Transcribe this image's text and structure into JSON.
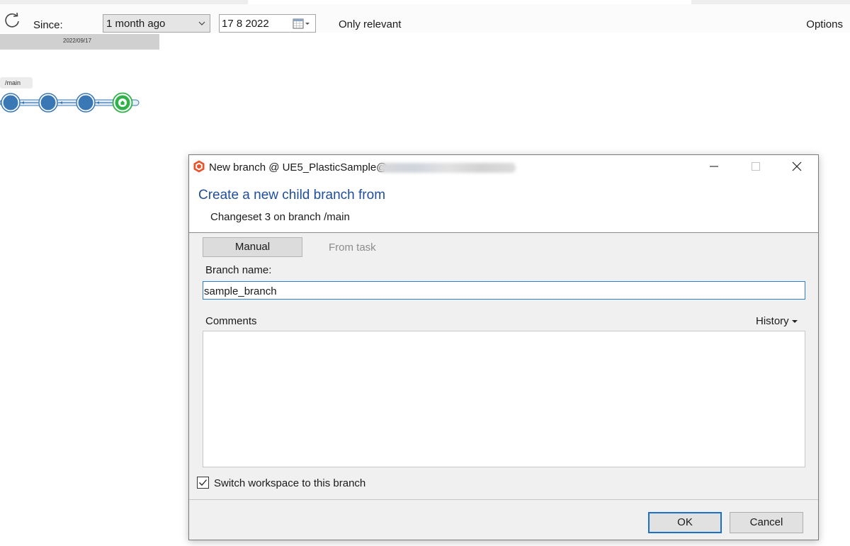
{
  "toolbar": {
    "since_label": "Since:",
    "since_value": "1 month ago",
    "date_value": "17  8  2022",
    "only_relevant": "Only relevant",
    "options": "Options"
  },
  "graph": {
    "date_label": "2022/09/17",
    "branch_label": "/main",
    "changeset_count": 4
  },
  "dialog": {
    "title": "New branch @ UE5_PlasticSample@",
    "heading": "Create a new child branch from",
    "subheading": "Changeset 3 on branch /main",
    "tab_manual": "Manual",
    "tab_from_task": "From task",
    "branch_name_label": "Branch name:",
    "branch_name_value": "sample_branch",
    "comments_label": "Comments",
    "history_label": "History",
    "comments_value": "",
    "switch_label": "Switch workspace to this branch",
    "switch_checked": true,
    "ok_label": "OK",
    "cancel_label": "Cancel"
  },
  "colors": {
    "accent": "#1f4e9c",
    "changeset": "#3a78b5",
    "head": "#2fb24a",
    "focus_border": "#2f7fd0"
  }
}
